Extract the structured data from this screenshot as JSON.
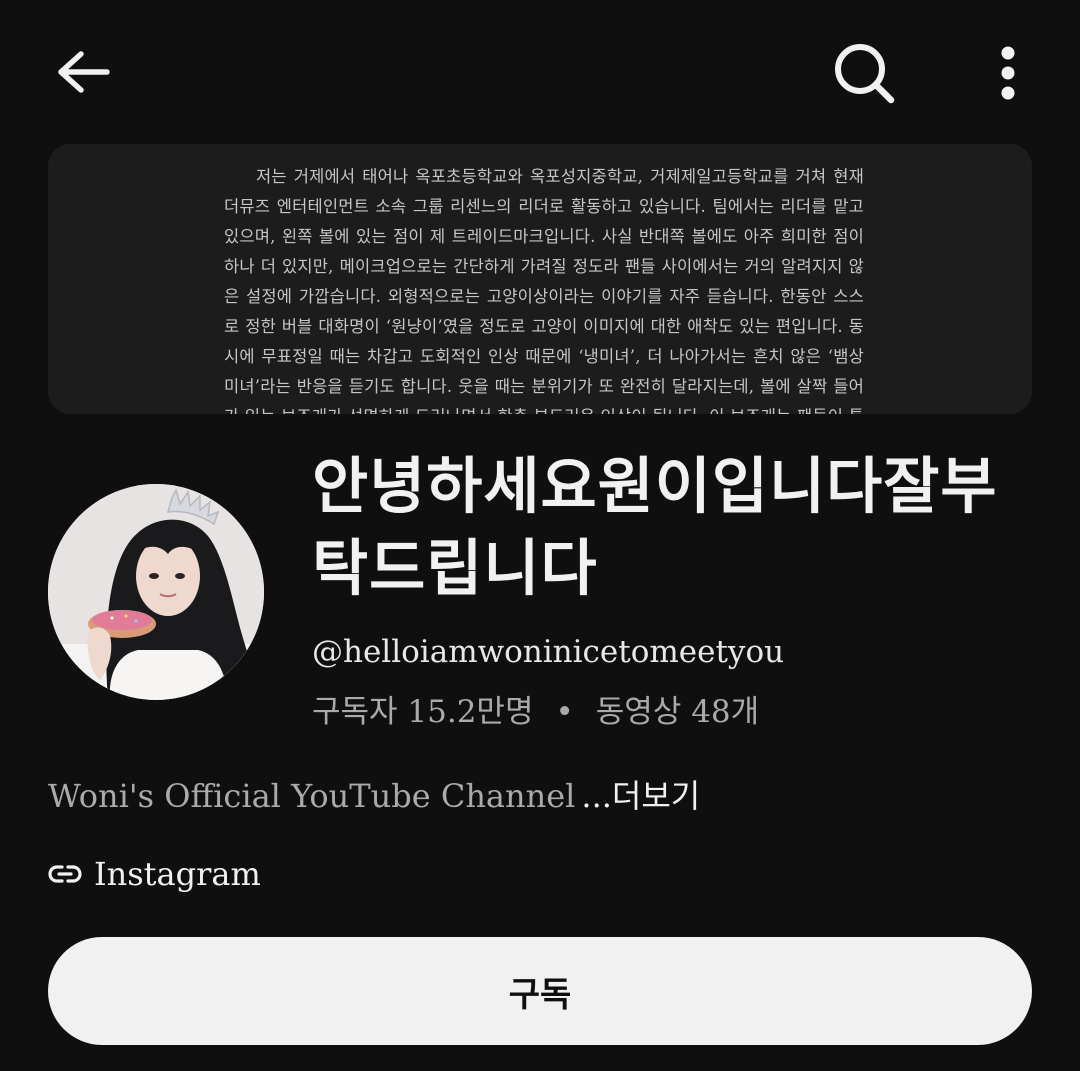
{
  "header": {
    "back_icon": "arrow-left-icon",
    "search_icon": "search-icon",
    "more_icon": "more-vertical-icon"
  },
  "banner": {
    "text": "저는 거제에서 태어나 옥포초등학교와 옥포성지중학교, 거제제일고등학교를 거쳐 현재 더뮤즈 엔터테인먼트 소속 그룹 리센느의 리더로 활동하고 있습니다. 팀에서는 리더를 맡고 있으며, 왼쪽 볼에 있는 점이 제 트레이드마크입니다. 사실 반대쪽 볼에도 아주 희미한 점이 하나 더 있지만, 메이크업으로는 간단하게 가려질 정도라 팬들 사이에서는 거의 알려지지 않은 설정에 가깝습니다. 외형적으로는 고양이상이라는 이야기를 자주 듣습니다. 한동안 스스로 정한 버블 대화명이 ‘원냥이’였을 정도로 고양이 이미지에 대한 애착도 있는 편입니다. 동시에 무표정일 때는 차갑고 도회적인 인상 때문에 ‘냉미녀’, 더 나아가서는 흔치 않은 ‘뱀상 미녀’라는 반응을 듣기도 합니다. 웃을 때는 분위기가 또 완전히 달라지는데, 볼에 살짝 들어가 있는 보조개가 선명하게 드러나면서 한층 부드러운 인상이 됩니다. 이 보조개는 팬들이 특히 좋아하는 포인트 중"
  },
  "channel": {
    "name": "안녕하세요원이입니다잘부탁드립니다",
    "handle": "@helloiamwoninicetomeetyou",
    "subscribers": "구독자 15.2만명",
    "separator": "•",
    "videos": "동영상 48개",
    "description": "Woni's Official YouTube Channel",
    "more_label": "...더보기",
    "link_label": "Instagram",
    "link_icon": "link-icon",
    "avatar_icon": "avatar"
  },
  "actions": {
    "subscribe_label": "구독"
  },
  "colors": {
    "background": "#0f0f0f",
    "primary_text": "#f1f1f1",
    "secondary_text": "#aaaaaa",
    "banner_bg": "#1c1c1c",
    "button_bg": "#f1f1f1"
  }
}
